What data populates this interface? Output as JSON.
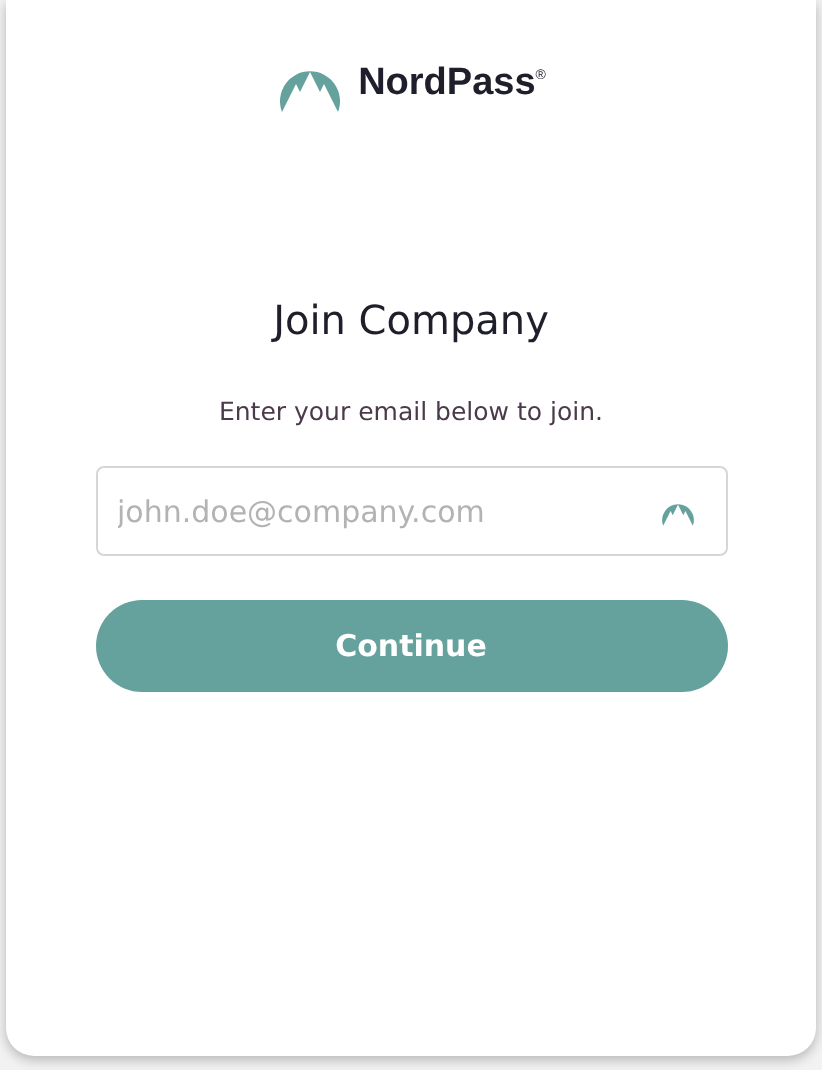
{
  "logo": {
    "name": "NordPass$^{®}$"
  },
  "title": "Join Company",
  "subtitle": "Enter your email below to join.",
  "email_field": {
    "placeholder": "john.doe@company.com"
  },
  "buttons": [
    {
      "label": "Continue"
    }
  ]
}
